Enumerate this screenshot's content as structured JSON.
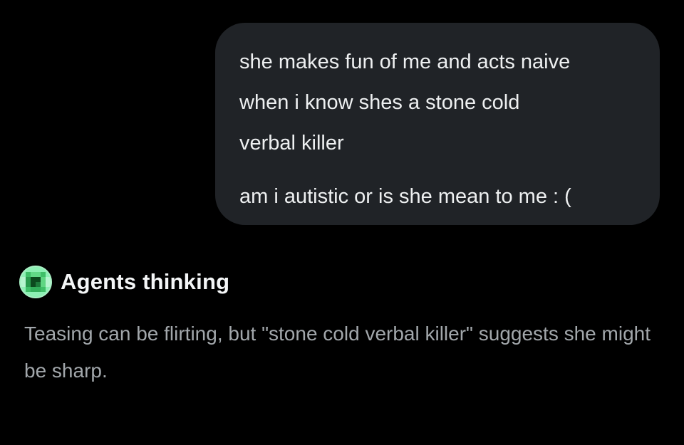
{
  "user_message": {
    "paragraph_1": [
      "she makes fun of me and acts naive",
      "when i know shes a stone cold",
      "verbal killer"
    ],
    "paragraph_2": "am i autistic or is she mean to me : ("
  },
  "agent": {
    "avatar_icon": "pixel-orb-icon",
    "title": "Agents thinking",
    "text": "Teasing can be flirting, but \"stone cold verbal killer\" suggests she might be sharp."
  },
  "colors": {
    "background": "#000000",
    "bubble": "#202327",
    "avatar_green": "#7ce8a6",
    "avatar_dark": "#0c4a1e"
  }
}
